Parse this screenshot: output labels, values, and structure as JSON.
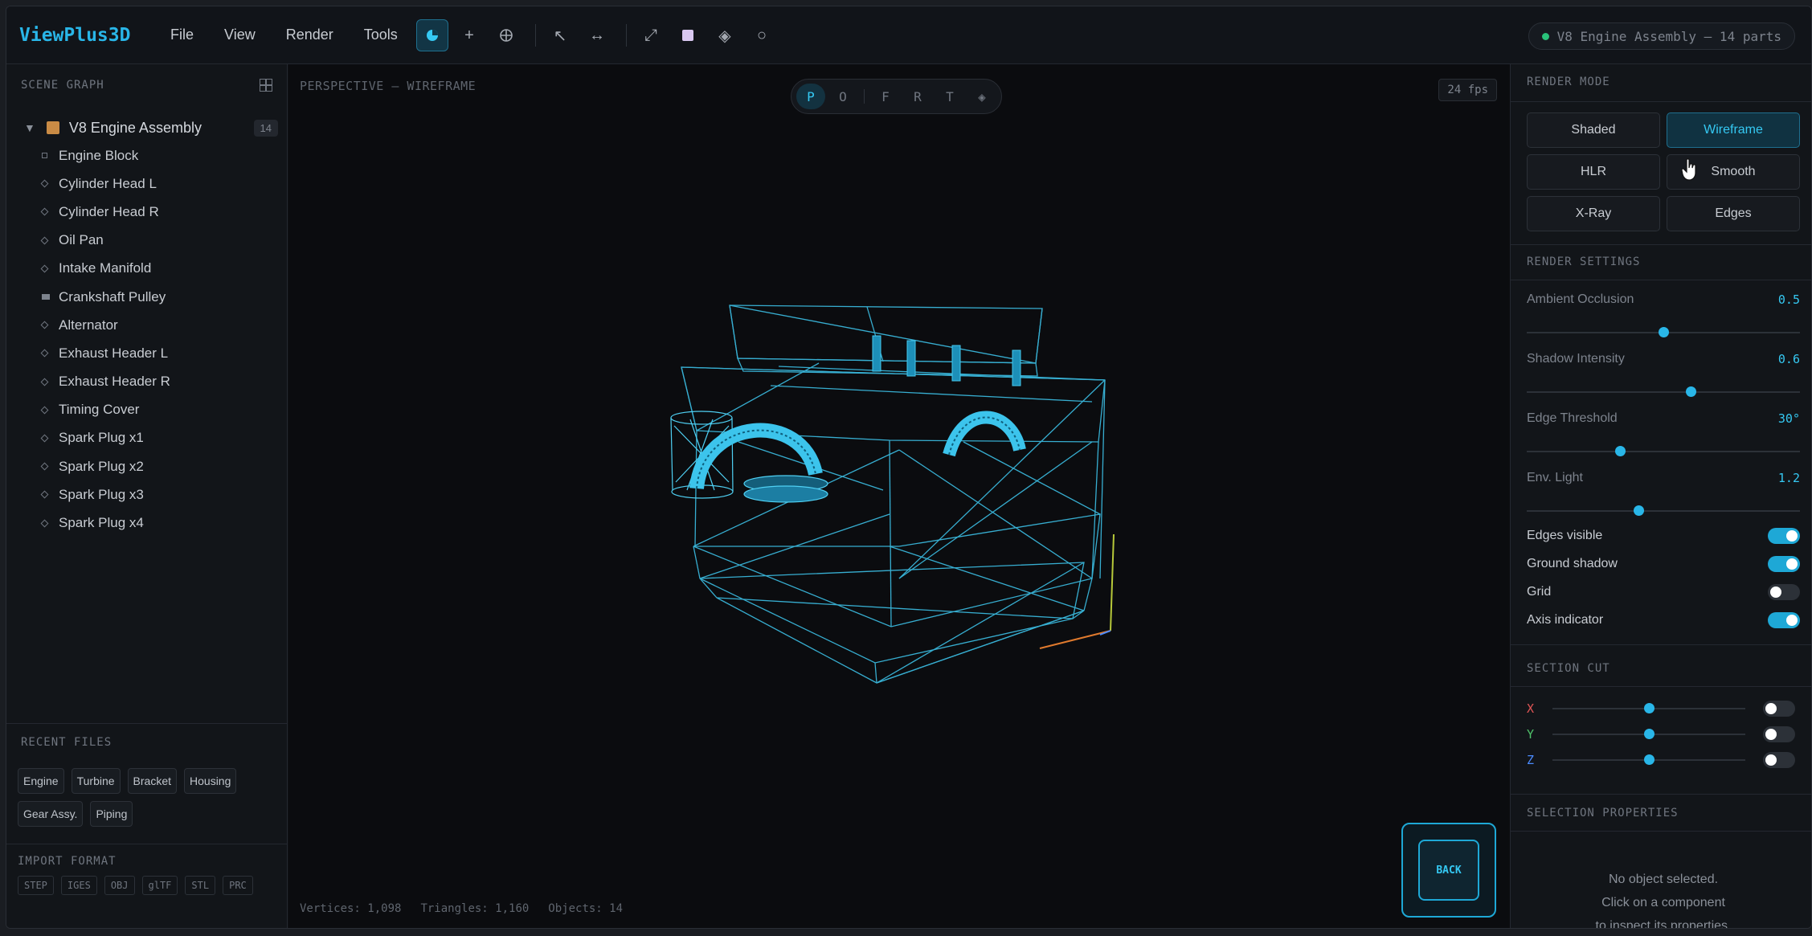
{
  "app": {
    "name": "ViewPlus3D",
    "menu": [
      "File",
      "View",
      "Render",
      "Tools"
    ],
    "status": "V8 Engine Assembly — 14 parts"
  },
  "toolbar": {
    "icons": [
      "shaded-sphere-icon",
      "add-icon",
      "crosshair-icon",
      "select-arrow-icon",
      "measure-icon",
      "expand-icon",
      "cube-face-icon",
      "snap-icon",
      "orbit-icon"
    ]
  },
  "scene": {
    "title": "SCENE GRAPH",
    "root": "V8 Engine Assembly",
    "count": "14",
    "items": [
      "Engine Block",
      "Cylinder Head L",
      "Cylinder Head R",
      "Oil Pan",
      "Intake Manifold",
      "Crankshaft Pulley",
      "Alternator",
      "Exhaust Header L",
      "Exhaust Header R",
      "Timing Cover",
      "Spark Plug x1",
      "Spark Plug x2",
      "Spark Plug x3",
      "Spark Plug x4"
    ]
  },
  "recent": {
    "title": "RECENT FILES",
    "files": [
      "Engine",
      "Turbine",
      "Bracket",
      "Housing",
      "Gear Assy.",
      "Piping"
    ]
  },
  "import": {
    "title": "IMPORT FORMAT",
    "formats": [
      "STEP",
      "IGES",
      "OBJ",
      "glTF",
      "STL",
      "PRC"
    ]
  },
  "viewport": {
    "label": "PERSPECTIVE — WIREFRAME",
    "fps": "24 fps",
    "views": [
      "P",
      "O",
      "F",
      "R",
      "T",
      "◈"
    ],
    "stats": {
      "vertices": "Vertices: 1,098",
      "triangles": "Triangles: 1,160",
      "objects": "Objects: 14"
    },
    "back": "BACK"
  },
  "panel": {
    "render_mode_title": "RENDER MODE",
    "modes": [
      "Shaded",
      "Wireframe",
      "HLR",
      "Smooth",
      "X-Ray",
      "Edges"
    ],
    "active_mode": "Wireframe",
    "settings_title": "RENDER SETTINGS",
    "sliders": [
      {
        "label": "Ambient Occlusion",
        "value": "0.5",
        "pos": 0.5
      },
      {
        "label": "Shadow Intensity",
        "value": "0.6",
        "pos": 0.6
      },
      {
        "label": "Edge Threshold",
        "value": "30°",
        "pos": 0.34
      },
      {
        "label": "Env. Light",
        "value": "1.2",
        "pos": 0.41
      }
    ],
    "toggles": [
      {
        "label": "Edges visible",
        "on": true
      },
      {
        "label": "Ground shadow",
        "on": true
      },
      {
        "label": "Grid",
        "on": false
      },
      {
        "label": "Axis indicator",
        "on": true
      }
    ],
    "section_title": "SECTION CUT",
    "cuts": [
      {
        "axis": "X",
        "color": "#e05555"
      },
      {
        "axis": "Y",
        "color": "#4fc36a"
      },
      {
        "axis": "Z",
        "color": "#4a8bff"
      }
    ],
    "selection_title": "SELECTION PROPERTIES",
    "selection_msg": [
      "No object selected.",
      "Click on a component",
      "to inspect its properties."
    ]
  }
}
